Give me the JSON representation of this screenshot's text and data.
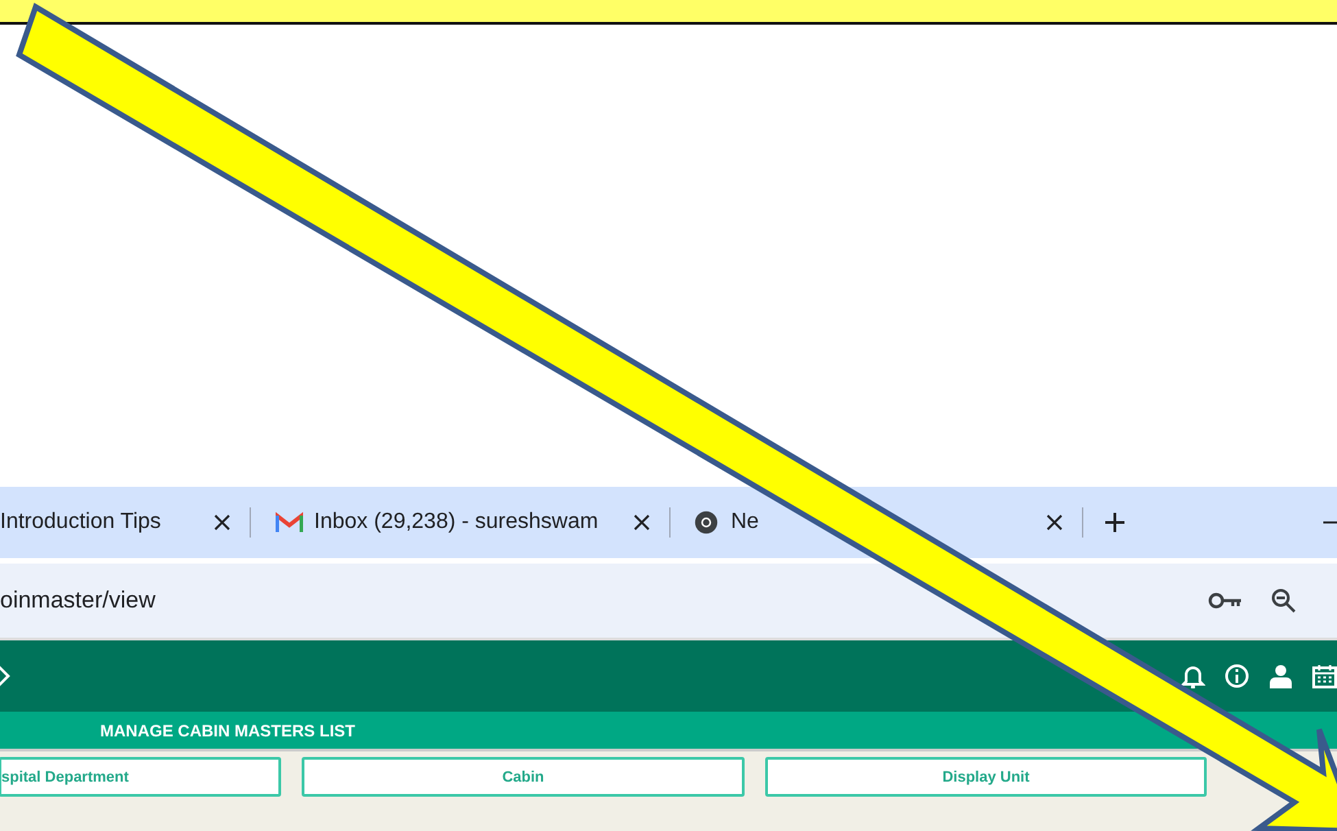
{
  "browser": {
    "tabs": [
      {
        "title": "Introduction Tips",
        "kind": "plain"
      },
      {
        "title": "Inbox (29,238) - sureshswam",
        "kind": "mail"
      },
      {
        "title": "Ne",
        "kind": "browser"
      }
    ],
    "address": "oinmaster/view"
  },
  "app": {
    "section_title": "MANAGE CABIN MASTERS LIST",
    "fields": [
      {
        "label": "spital Department"
      },
      {
        "label": "Cabin"
      },
      {
        "label": "Display Unit"
      }
    ]
  }
}
